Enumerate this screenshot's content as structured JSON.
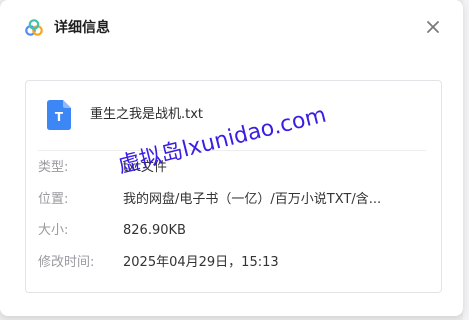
{
  "dialog": {
    "title": "详细信息",
    "close_icon": "close-icon",
    "logo_icon": "app-logo-icon"
  },
  "file": {
    "icon": "text-file-icon",
    "icon_letter": "T",
    "icon_color": "#3d86f5",
    "name": "重生之我是战机.txt"
  },
  "details": [
    {
      "label": "类型:",
      "value": "txt文件"
    },
    {
      "label": "位置:",
      "value": "我的网盘/电子书（一亿）/百万小说TXT/含..."
    },
    {
      "label": "大小:",
      "value": "826.90KB"
    },
    {
      "label": "修改时间:",
      "value": "2025年04月29日，15:13"
    }
  ],
  "watermark": "虚拟岛lxunidao.com"
}
